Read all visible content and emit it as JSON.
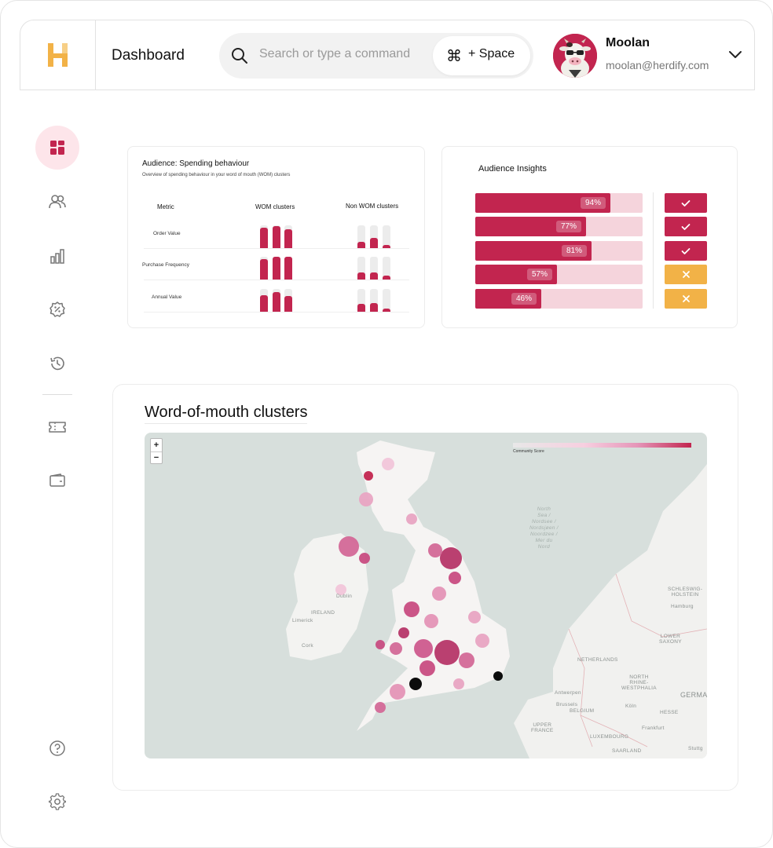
{
  "header": {
    "page_title": "Dashboard",
    "search_placeholder": "Search or type a command",
    "shortcut_symbol": "⌘",
    "shortcut_label": "+ Space",
    "user_name": "Moolan",
    "user_email": "moolan@herdify.com"
  },
  "brand": {
    "logo_letter": "H",
    "accent": "#c2254f",
    "logo_color": "#f2b247"
  },
  "sidebar": {
    "items": [
      {
        "name": "dashboard-icon",
        "active": true
      },
      {
        "name": "audience-icon",
        "active": false
      },
      {
        "name": "analytics-icon",
        "active": false
      },
      {
        "name": "offers-icon",
        "active": false
      },
      {
        "name": "history-icon",
        "active": false
      },
      {
        "name": "tickets-icon",
        "active": false
      },
      {
        "name": "wallet-icon",
        "active": false
      },
      {
        "name": "help-icon",
        "active": false
      },
      {
        "name": "settings-icon",
        "active": false
      }
    ]
  },
  "spending": {
    "title": "Audience: Spending behaviour",
    "subtitle": "Overview of spending behaviour in your word of mouth (WOM) clusters",
    "col_metric": "Metric",
    "col_wom": "WOM clusters",
    "col_non_wom": "Non WOM clusters",
    "rows": [
      {
        "label": "Order Value",
        "wom": [
          0.9,
          0.97,
          0.83
        ],
        "non_wom": [
          0.28,
          0.46,
          0.14
        ]
      },
      {
        "label": "Purchase Frequency",
        "wom": [
          0.9,
          1.0,
          1.0
        ],
        "non_wom": [
          0.3,
          0.3,
          0.18
        ]
      },
      {
        "label": "Annual Value",
        "wom": [
          0.72,
          0.85,
          0.68
        ],
        "non_wom": [
          0.33,
          0.38,
          0.13
        ]
      }
    ]
  },
  "insights": {
    "title": "Audience Insights",
    "rows": [
      {
        "percent": 94,
        "label": "94%",
        "status": "pass"
      },
      {
        "percent": 77,
        "label": "77%",
        "status": "pass"
      },
      {
        "percent": 81,
        "label": "81%",
        "status": "pass"
      },
      {
        "percent": 57,
        "label": "57%",
        "status": "fail"
      },
      {
        "percent": 46,
        "label": "46%",
        "status": "fail"
      }
    ],
    "pass_color": "#c2254f",
    "fail_color": "#f2b247"
  },
  "map": {
    "title": "Word-of-mouth clusters",
    "zoom_in": "+",
    "zoom_out": "−",
    "legend_label": "Community Score",
    "labels": {
      "ireland": "IRELAND",
      "dublin": "Dublin",
      "limerick": "Limerick",
      "cork": "Cork",
      "north_sea": "North\nSea /\nNordsee /\nNordsjøen /\nNoordzee /\nMer du\nNord",
      "netherlands": "NETHERLANDS",
      "belgium": "BELGIUM",
      "luxembourg": "LUXEMBOURG",
      "upper_france": "UPPER\nFRANCE",
      "saarland": "SAARLAND",
      "hesse": "HESSE",
      "lower_saxony": "LOWER\nSAXONY",
      "nrw": "NORTH\nRHINE-\nWESTPHALIA",
      "schleswig": "SCHLESWIG-\nHOLSTEIN",
      "germany": "GERMA",
      "hamburg": "Hamburg",
      "antwerp": "Antwerpen",
      "brussels": "Brussels",
      "cologne": "Köln",
      "frankfurt": "Frankfurt",
      "stuttgart": "Stuttg"
    }
  }
}
